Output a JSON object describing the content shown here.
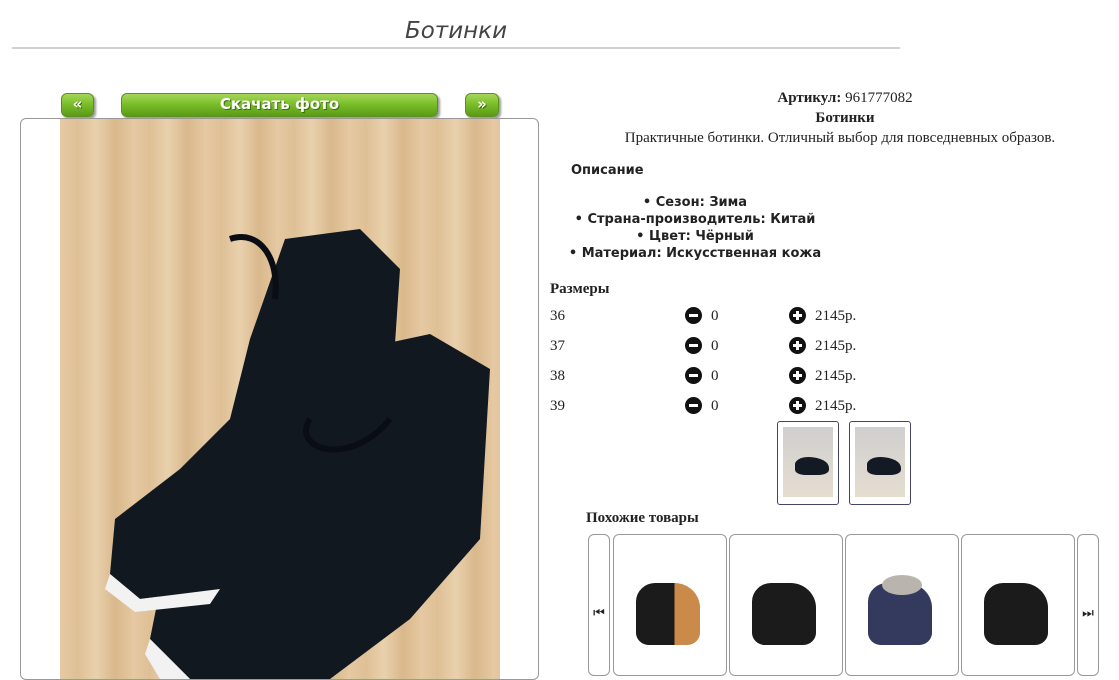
{
  "page": {
    "title": "Ботинки"
  },
  "photo_nav": {
    "prev_label": "«",
    "download_label": "Скачать фото",
    "next_label": "»"
  },
  "product": {
    "sku_label": "Артикул:",
    "sku_value": "961777082",
    "name": "Ботинки",
    "short_description": "Практичные ботинки. Отличный выбор для повседневных образов.",
    "description_heading": "Описание",
    "attributes": [
      "Сезон: Зима",
      "Страна-производитель: Китай",
      "Цвет: Чёрный",
      "Материал: Искусственная кожа"
    ]
  },
  "sizes": {
    "heading": "Размеры",
    "rows": [
      {
        "size": "36",
        "qty": "0",
        "price": "2145р."
      },
      {
        "size": "37",
        "qty": "0",
        "price": "2145р."
      },
      {
        "size": "38",
        "qty": "0",
        "price": "2145р."
      },
      {
        "size": "39",
        "qty": "0",
        "price": "2145р."
      }
    ]
  },
  "similar": {
    "heading": "Похожие товары",
    "prev_icon": "skip-back-icon",
    "next_icon": "skip-forward-icon"
  },
  "icons": {
    "minus": "minus-circle-icon",
    "plus": "plus-circle-icon"
  },
  "colors": {
    "button_green": "#7bbf2a",
    "text": "#222222"
  }
}
